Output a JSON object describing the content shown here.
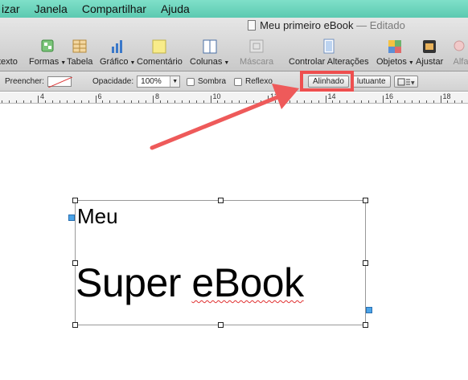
{
  "menubar": {
    "items": [
      "izar",
      "Janela",
      "Compartilhar",
      "Ajuda"
    ]
  },
  "window": {
    "title": "Meu primeiro eBook",
    "status": "— Editado"
  },
  "toolbar": {
    "tools": [
      {
        "label": "texto"
      },
      {
        "label": "Formas",
        "menu": true
      },
      {
        "label": "Tabela"
      },
      {
        "label": "Gráfico",
        "menu": true
      },
      {
        "label": "Comentário"
      },
      {
        "label": "Colunas",
        "menu": true
      },
      {
        "label": "Máscara",
        "disabled": true
      },
      {
        "label": "Controlar Alterações"
      },
      {
        "label": "Objetos",
        "menu": true
      },
      {
        "label": "Ajustar"
      },
      {
        "label": "Alfa",
        "disabled": true
      }
    ]
  },
  "formatbar": {
    "fill_label": "Preencher:",
    "opacity_label": "Opacidade:",
    "opacity_value": "100%",
    "shadow_label": "Sombra",
    "reflection_label": "Reflexo",
    "inline_button": "Alinhado",
    "floating_button": "lutuante"
  },
  "ruler": {
    "labels": [
      "4",
      "6",
      "8",
      "10",
      "12",
      "14",
      "16",
      "18"
    ]
  },
  "document": {
    "line1": "Meu",
    "line2_word1": "Super",
    "line2_word2": "eBook"
  },
  "colors": {
    "menubar": "#6ad6bd",
    "annotation": "#ee4f4f",
    "selection_handle": "#222222"
  }
}
